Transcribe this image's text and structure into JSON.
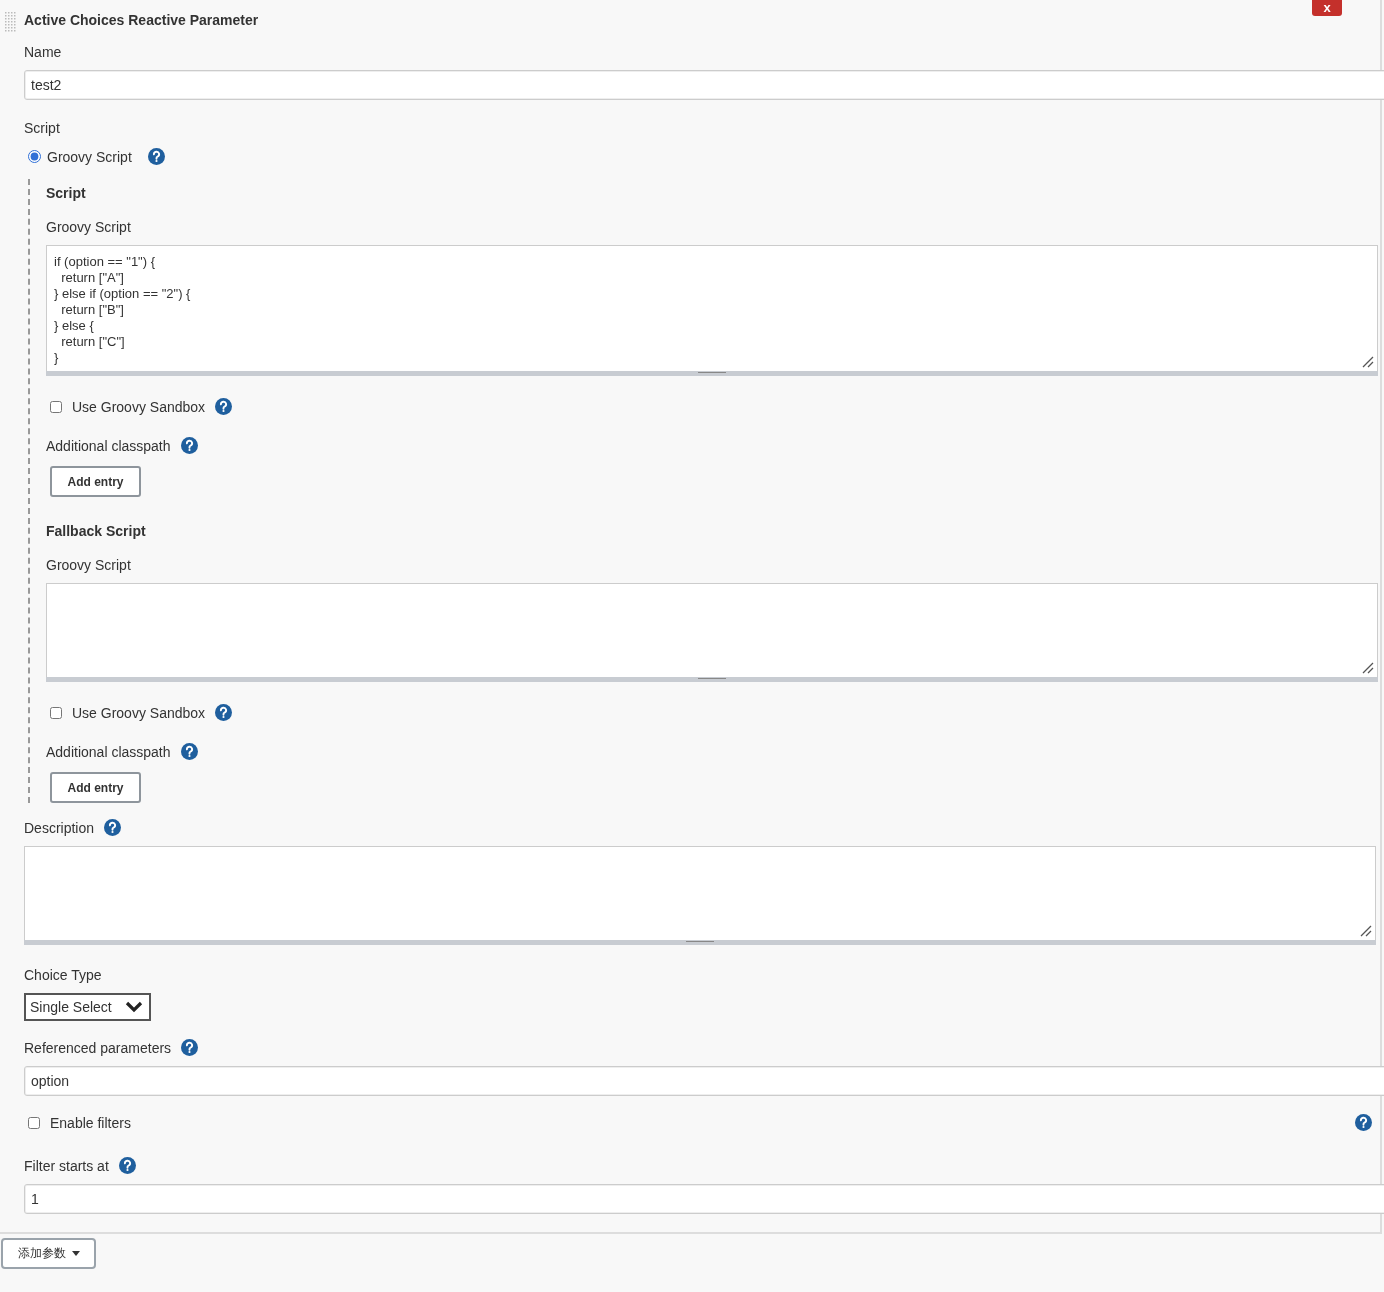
{
  "header": {
    "title": "Active Choices Reactive Parameter",
    "close_label": "x"
  },
  "name": {
    "label": "Name",
    "value": "test2"
  },
  "script": {
    "label": "Script",
    "options": [
      {
        "label": "Groovy Script",
        "selected": true
      }
    ],
    "sections": [
      {
        "heading": "Script",
        "editor_label": "Groovy Script",
        "code": "if (option == \"1\") {\n  return [\"A\"]\n} else if (option == \"2\") {\n  return [\"B\"]\n} else {\n  return [\"C\"]\n}",
        "sandbox": {
          "label": "Use Groovy Sandbox",
          "checked": false
        },
        "classpath_label": "Additional classpath",
        "add_button": "Add entry"
      },
      {
        "heading": "Fallback Script",
        "editor_label": "Groovy Script",
        "sandbox": {
          "label": "Use Groovy Sandbox",
          "checked": false
        },
        "classpath_label": "Additional classpath",
        "add_button": "Add entry"
      }
    ]
  },
  "description": {
    "label": "Description"
  },
  "choice_type": {
    "label": "Choice Type",
    "value": "Single Select"
  },
  "referenced_parameters": {
    "label": "Referenced parameters",
    "value": "option"
  },
  "enable_filters": {
    "label": "Enable filters",
    "checked": false
  },
  "filter_starts_at": {
    "label": "Filter starts at",
    "value": "1"
  },
  "add_parameter_button": "添加参数"
}
